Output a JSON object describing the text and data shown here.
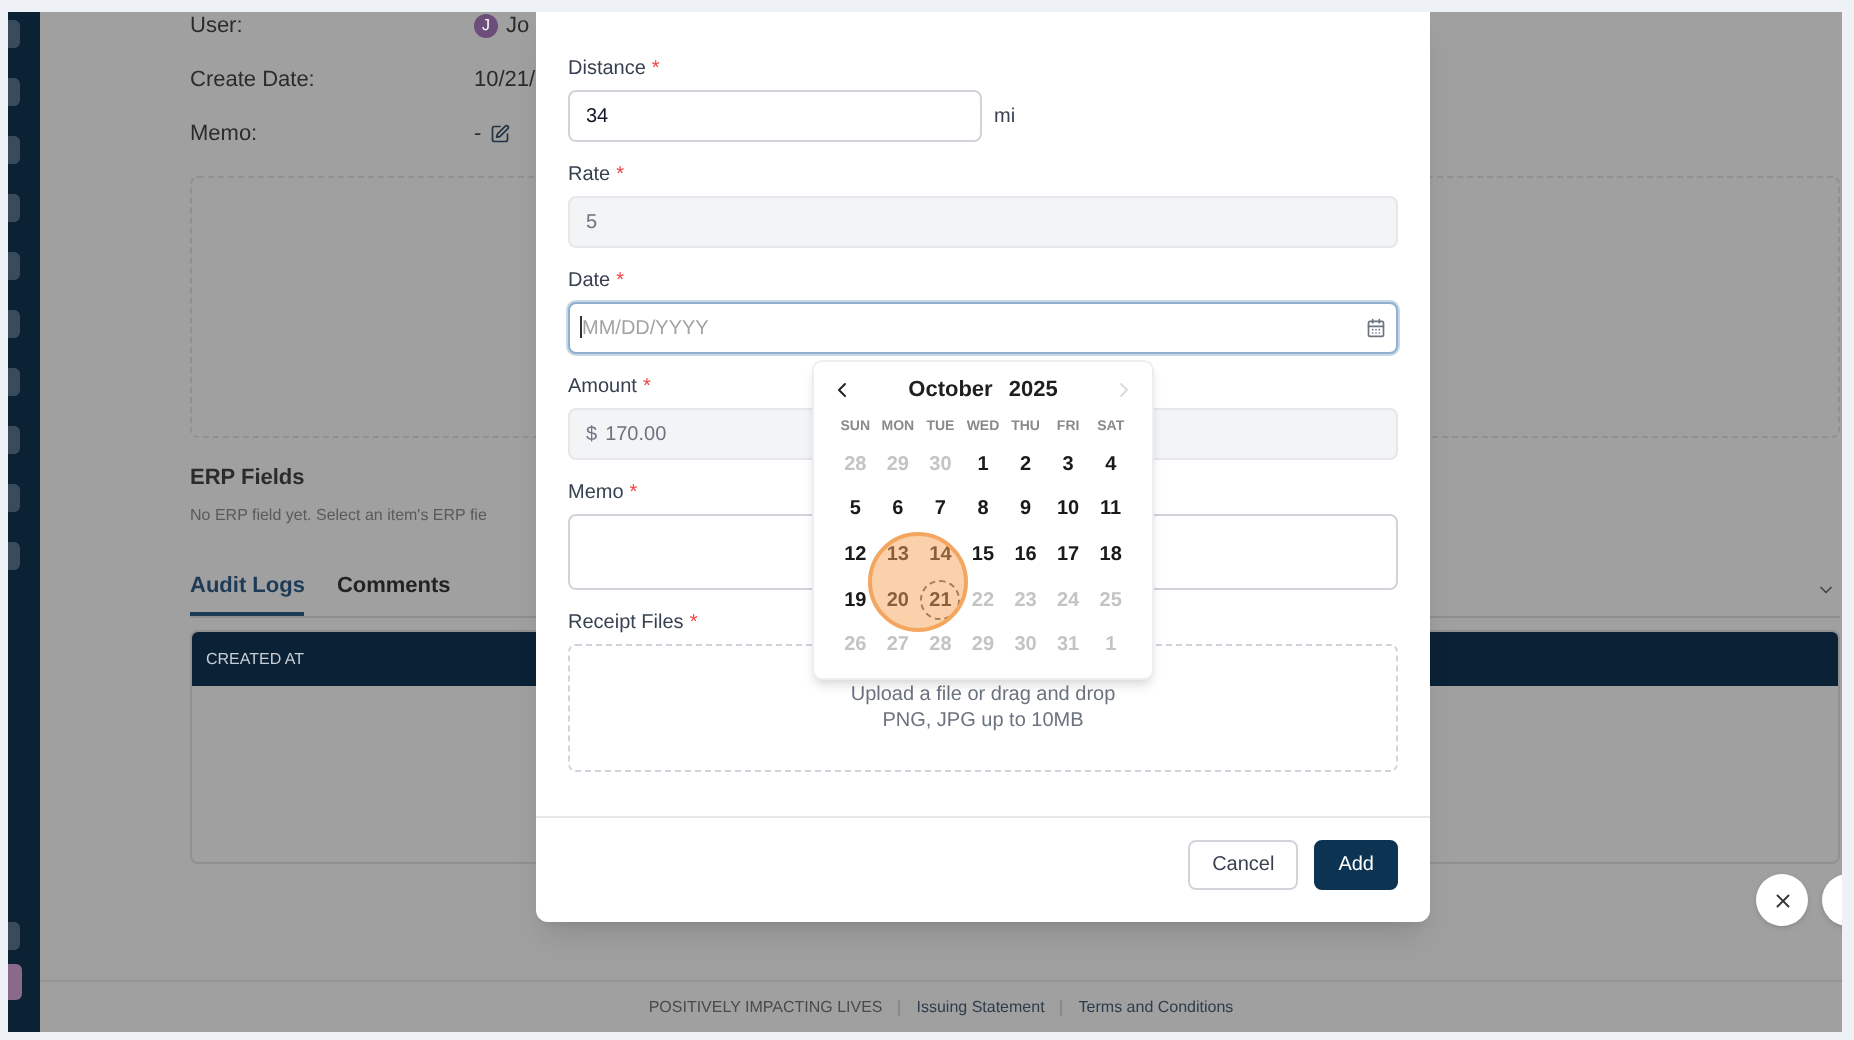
{
  "details": [
    {
      "label": "User:",
      "avatar": "J",
      "value": "Jo"
    },
    {
      "label": "Create Date:",
      "value": "10/21/"
    },
    {
      "label": "Memo:",
      "value": "-",
      "editable": true
    }
  ],
  "erp": {
    "title": "ERP Fields",
    "message": "No ERP field yet. Select an item's ERP fie"
  },
  "tabs": [
    {
      "label": "Audit Logs",
      "selected": true
    },
    {
      "label": "Comments",
      "selected": false
    }
  ],
  "table": {
    "columns": [
      "CREATED AT"
    ]
  },
  "footer": {
    "tagline": "POSITIVELY IMPACTING LIVES",
    "links": [
      "Issuing Statement",
      "Terms and Conditions"
    ]
  },
  "modal": {
    "fields": [
      {
        "kind": "input",
        "label": "Distance",
        "required_mark": "*",
        "value": "34",
        "unit": "mi",
        "disabled": false
      },
      {
        "kind": "input",
        "label": "Rate",
        "required_mark": "*",
        "value": "5",
        "disabled": true
      },
      {
        "kind": "date",
        "label": "Date",
        "required_mark": "*",
        "placeholder": "MM/DD/YYYY",
        "focused": true
      },
      {
        "kind": "input",
        "label": "Amount",
        "required_mark": "*",
        "prefix": "$",
        "value": "170.00",
        "disabled": true
      },
      {
        "kind": "textarea",
        "label": "Memo",
        "required_mark": "*"
      },
      {
        "kind": "upload",
        "label": "Receipt Files",
        "required_mark": "*",
        "hint": "Upload a file or drag and drop",
        "formats": "PNG, JPG up to 10MB"
      }
    ],
    "buttons": [
      {
        "label": "Cancel",
        "kind": "secondary"
      },
      {
        "label": "Add",
        "kind": "primary"
      }
    ]
  },
  "calendar": {
    "month": "October",
    "year": "2025",
    "next_disabled": true,
    "weekdays": [
      "SUN",
      "MON",
      "TUE",
      "WED",
      "THU",
      "FRI",
      "SAT"
    ],
    "weeks": [
      [
        {
          "day": "28",
          "muted": true
        },
        {
          "day": "29",
          "muted": true
        },
        {
          "day": "30",
          "muted": true
        },
        {
          "day": "1",
          "muted": false
        },
        {
          "day": "2",
          "muted": false
        },
        {
          "day": "3",
          "muted": false
        },
        {
          "day": "4",
          "muted": false
        }
      ],
      [
        {
          "day": "5",
          "muted": false
        },
        {
          "day": "6",
          "muted": false
        },
        {
          "day": "7",
          "muted": false
        },
        {
          "day": "8",
          "muted": false
        },
        {
          "day": "9",
          "muted": false
        },
        {
          "day": "10",
          "muted": false
        },
        {
          "day": "11",
          "muted": false
        }
      ],
      [
        {
          "day": "12",
          "muted": false
        },
        {
          "day": "13",
          "muted": false
        },
        {
          "day": "14",
          "muted": false
        },
        {
          "day": "15",
          "muted": false
        },
        {
          "day": "16",
          "muted": false
        },
        {
          "day": "17",
          "muted": false
        },
        {
          "day": "18",
          "muted": false
        }
      ],
      [
        {
          "day": "19",
          "muted": false
        },
        {
          "day": "20",
          "muted": false
        },
        {
          "day": "21",
          "muted": false,
          "today": true
        },
        {
          "day": "22",
          "muted": true
        },
        {
          "day": "23",
          "muted": true
        },
        {
          "day": "24",
          "muted": true
        },
        {
          "day": "25",
          "muted": true
        }
      ],
      [
        {
          "day": "26",
          "muted": true
        },
        {
          "day": "27",
          "muted": true
        },
        {
          "day": "28",
          "muted": true
        },
        {
          "day": "29",
          "muted": true
        },
        {
          "day": "30",
          "muted": true
        },
        {
          "day": "31",
          "muted": true
        },
        {
          "day": "1",
          "muted": true
        }
      ]
    ]
  }
}
